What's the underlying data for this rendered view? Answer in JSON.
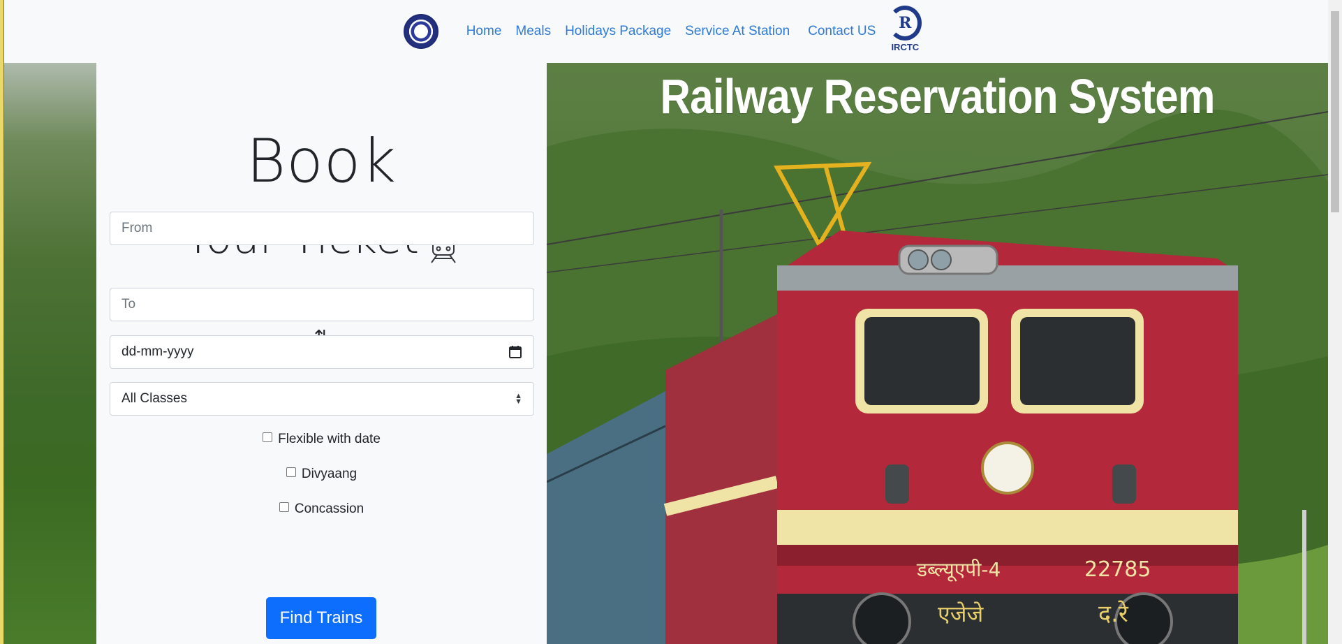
{
  "nav": {
    "links": [
      "Home",
      "Meals",
      "Holidays Package",
      "Service At Station",
      "Contact US"
    ],
    "irctc_logo_text": "IRCTC"
  },
  "booking": {
    "title_line1": "Book",
    "title_line2": "Your Ticket",
    "from_placeholder": "From",
    "swap_symbol": "⇅",
    "to_placeholder": "To",
    "date_placeholder": "dd-mm-yyyy",
    "class_selected": "All Classes",
    "checkboxes": [
      "Flexible with date",
      "Divyaang",
      "Concassion"
    ],
    "find_button": "Find Trains"
  },
  "hero": {
    "title": "Railway Reservation System",
    "loco_number": "22785",
    "loco_class": "डब्ल्यूएपी-4",
    "loco_shed": "एजेजे",
    "loco_region": "द.रे"
  },
  "colors": {
    "accent": "#0d6efd",
    "nav_link": "#2f7ad8",
    "loco_red": "#b3283a",
    "loco_cream": "#f0e3a6"
  }
}
